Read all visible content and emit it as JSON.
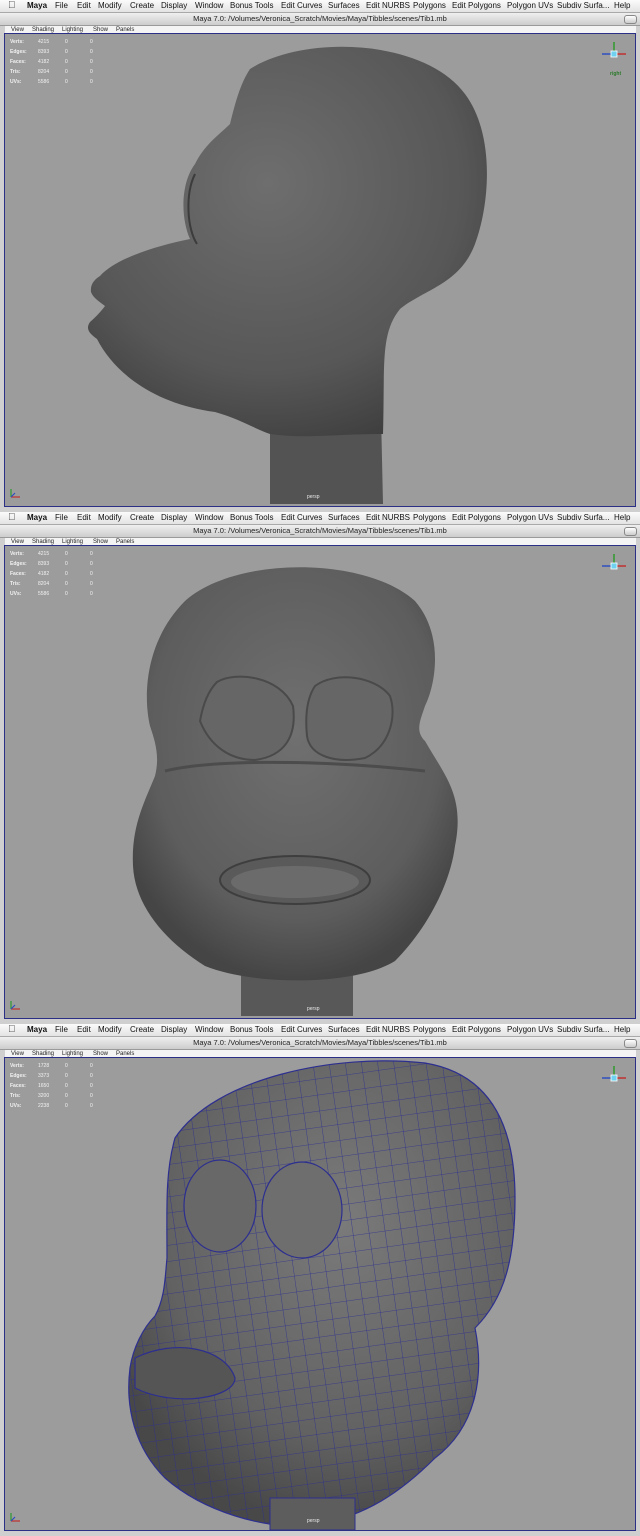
{
  "menu": {
    "app_name": "Maya",
    "items": [
      "File",
      "Edit",
      "Modify",
      "Create",
      "Display",
      "Window",
      "Bonus Tools",
      "Edit Curves",
      "Surfaces",
      "Edit NURBS",
      "Polygons",
      "Edit Polygons",
      "Polygon UVs",
      "Subdiv Surfa...",
      "Help"
    ]
  },
  "window_title": "Maya 7.0:  /Volumes/Veronica_Scratch/Movies/Maya/Tibbles/scenes/Tib1.mb",
  "panel_menu": [
    "View",
    "Shading",
    "Lighting",
    "Show",
    "Panels"
  ],
  "hud_labels": [
    "Verts:",
    "Edges:",
    "Faces:",
    "Tris:",
    "UVs:"
  ],
  "panels": [
    {
      "camera": "persp",
      "cube_label": "right",
      "hud": {
        "values": [
          "4215",
          "8393",
          "4182",
          "8204",
          "5586"
        ],
        "col2": "0",
        "col3": "0"
      }
    },
    {
      "camera": "persp",
      "cube_label": "",
      "hud": {
        "values": [
          "4215",
          "8393",
          "4182",
          "8204",
          "5586"
        ],
        "col2": "0",
        "col3": "0"
      }
    },
    {
      "camera": "persp",
      "cube_label": "",
      "hud": {
        "values": [
          "1728",
          "3373",
          "1650",
          "3200",
          "2238"
        ],
        "col2": "0",
        "col3": "0"
      }
    }
  ],
  "colors": {
    "viewport_bg": "#9c9c9c",
    "mesh": "#5c5c5c",
    "wireframe": "#2d2f8f",
    "frame_border": "#2b2f86"
  }
}
